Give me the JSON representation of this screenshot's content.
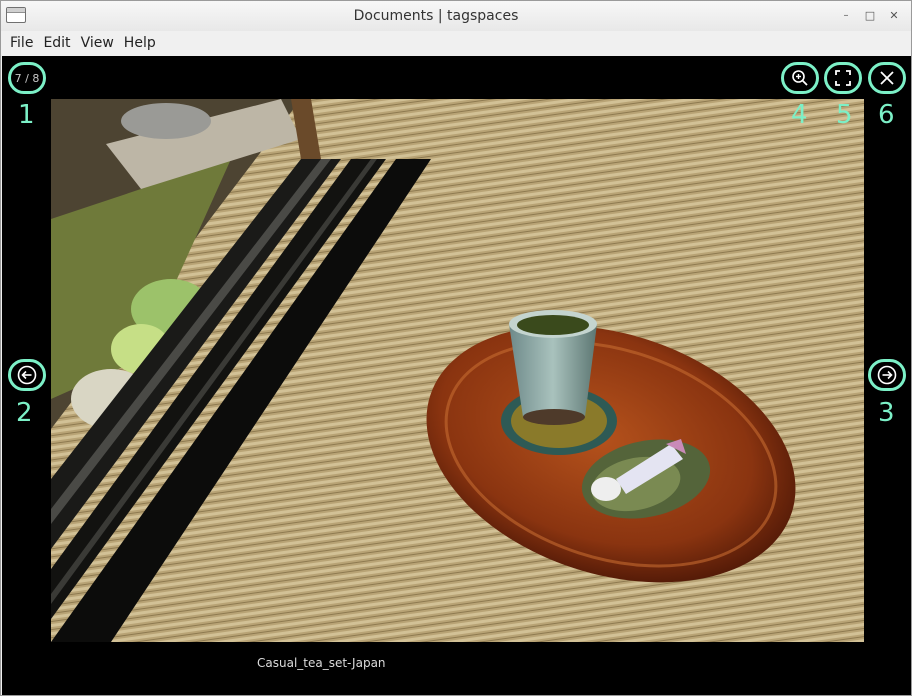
{
  "window": {
    "title": "Documents | tagspaces",
    "controls": {
      "minimize": "–",
      "maximize": "□",
      "close": "✕"
    }
  },
  "menu": [
    "File",
    "Edit",
    "View",
    "Help"
  ],
  "viewer": {
    "counter": "7 / 8",
    "caption": "Casual_tea_set-Japan",
    "buttons": {
      "zoom": "zoom-in-icon",
      "fullscreen": "fullscreen-icon",
      "close": "close-icon",
      "prev": "arrow-left-icon",
      "next": "arrow-right-icon"
    },
    "annotations": [
      "1",
      "2",
      "3",
      "4",
      "5",
      "6"
    ],
    "accent": "#7cf0c7"
  }
}
